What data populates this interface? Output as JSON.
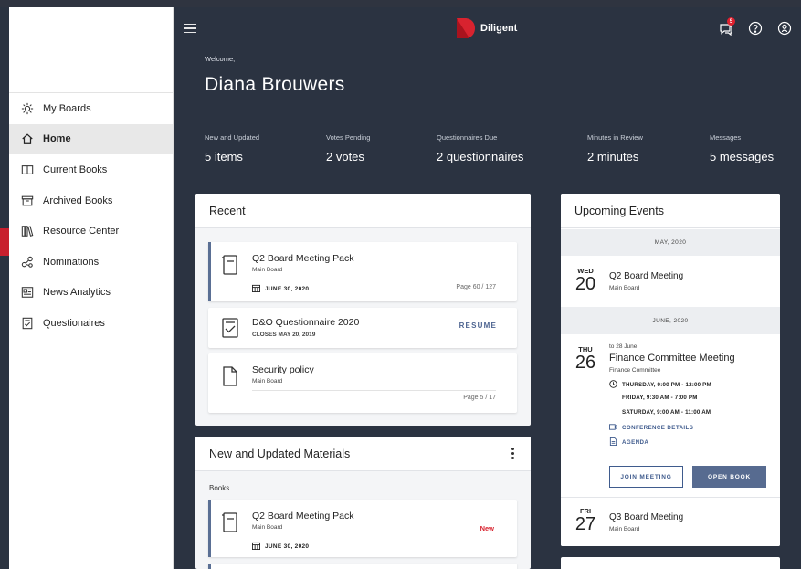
{
  "app": {
    "brand": "Diligent"
  },
  "header": {
    "notification_count": "5"
  },
  "welcome": {
    "greeting": "Welcome,",
    "name": "Diana Brouwers"
  },
  "stats": [
    {
      "label": "New and Updated",
      "value": "5 items"
    },
    {
      "label": "Votes Pending",
      "value": "2 votes"
    },
    {
      "label": "Questionnaires Due",
      "value": "2 questionnaires"
    },
    {
      "label": "Minutes in Review",
      "value": "2 minutes"
    },
    {
      "label": "Messages",
      "value": "5 messages"
    }
  ],
  "sidebar": {
    "items": [
      {
        "label": "My Boards",
        "icon": "boards-icon"
      },
      {
        "label": "Home",
        "icon": "home-icon"
      },
      {
        "label": "Current Books",
        "icon": "book-icon"
      },
      {
        "label": "Archived Books",
        "icon": "archive-icon"
      },
      {
        "label": "Resource Center",
        "icon": "library-icon"
      },
      {
        "label": "Nominations",
        "icon": "nominations-icon"
      },
      {
        "label": "News Analytics",
        "icon": "news-icon"
      },
      {
        "label": "Questionaires",
        "icon": "questionnaire-icon"
      }
    ]
  },
  "recent": {
    "title": "Recent",
    "items": [
      {
        "title": "Q2 Board Meeting Pack",
        "sub": "Main Board",
        "date": "JUNE 30, 2020",
        "page": "Page 60 / 127"
      },
      {
        "title": "D&O Questionnaire 2020",
        "sub": "CLOSES MAY 20, 2019",
        "action": "RESUME"
      },
      {
        "title": "Security policy",
        "sub": "Main Board",
        "page": "Page 5 / 17"
      }
    ]
  },
  "materials": {
    "title": "New and Updated Materials",
    "section": "Books",
    "items": [
      {
        "title": "Q2 Board Meeting Pack",
        "sub": "Main Board",
        "date": "JUNE 30, 2020",
        "tag": "New"
      }
    ]
  },
  "events": {
    "title": "Upcoming Events",
    "months": [
      "MAY, 2020",
      "JUNE, 2020"
    ],
    "list": [
      {
        "dow": "WED",
        "day": "20",
        "title": "Q2 Board Meeting",
        "sub": "Main Board"
      },
      {
        "dow": "THU",
        "day": "26",
        "range": "to 28 June",
        "title": "Finance Committee Meeting",
        "sub": "Finance Committee",
        "times": [
          "THURSDAY, 9:00 PM - 12:00 PM",
          "FRIDAY, 9:30 AM - 7:00 PM",
          "SATURDAY, 9:00 AM - 11:00 AM"
        ],
        "conference": "CONFERENCE DETAILS",
        "agenda": "AGENDA",
        "join": "JOIN MEETING",
        "open": "OPEN BOOK"
      },
      {
        "dow": "FRI",
        "day": "27",
        "title": "Q3 Board Meeting",
        "sub": "Main Board"
      }
    ]
  },
  "colors": {
    "accent": "#5a6f94",
    "header_bg": "#2b3341",
    "brand_red": "#d8232f"
  }
}
